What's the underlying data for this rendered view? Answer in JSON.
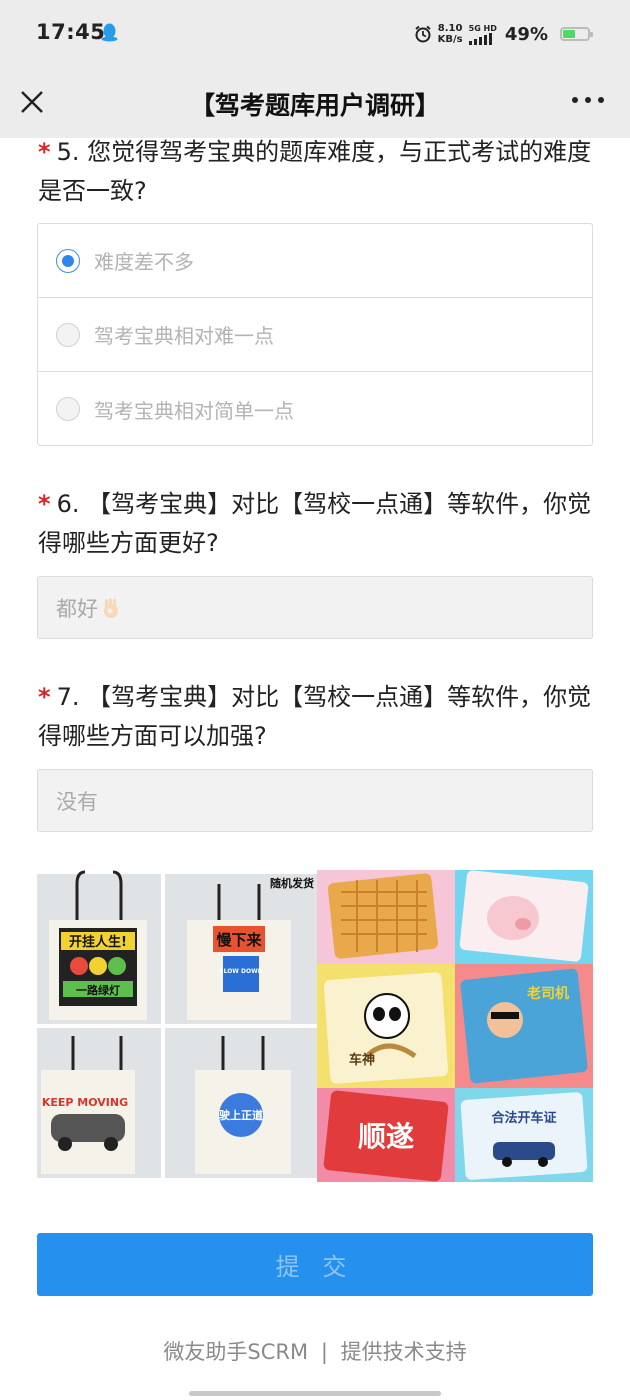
{
  "status_bar": {
    "time": "17:45",
    "net_speed_value": "8.10",
    "net_speed_unit": "KB/s",
    "signal_label": "5G HD",
    "battery": "49%",
    "battery_level": 0.49
  },
  "nav": {
    "title": "【驾考题库用户调研】"
  },
  "questions": [
    {
      "number": "5.",
      "required_mark": "*",
      "text": "您觉得驾考宝典的题库难度，与正式考试的难度是否一致?",
      "options": [
        {
          "label": "难度差不多",
          "selected": true
        },
        {
          "label": "驾考宝典相对难一点",
          "selected": false
        },
        {
          "label": "驾考宝典相对简单一点",
          "selected": false
        }
      ]
    },
    {
      "number": "6.",
      "required_mark": "*",
      "text": "【驾考宝典】对比【驾校一点通】等软件，你觉得哪些方面更好?",
      "answer": "都好"
    },
    {
      "number": "7.",
      "required_mark": "*",
      "text": "【驾考宝典】对比【驾校一点通】等软件，你觉得哪些方面可以加强?",
      "answer": "没有"
    }
  ],
  "promo": {
    "random_ship": "随机发货",
    "bag1_line1": "开挂人生!",
    "bag1_line2": "一路绿灯",
    "bag2_line1": "慢下来",
    "bag2_line2": "SLOW DOWN",
    "bag3_text": "KEEP MOVING",
    "bag4_text": "驶上正道",
    "pad_panda": "车神",
    "pad_driver": "老司机",
    "pad_shun": "顺遂",
    "pad_legal": "合法开车证"
  },
  "submit_label": "提 交",
  "footer": {
    "brand": "微友助手SCRM",
    "separator": "|",
    "support": "提供技术支持"
  },
  "colors": {
    "accent": "#2690ee",
    "required": "#e02020",
    "radio_selected": "#2f86ea"
  }
}
